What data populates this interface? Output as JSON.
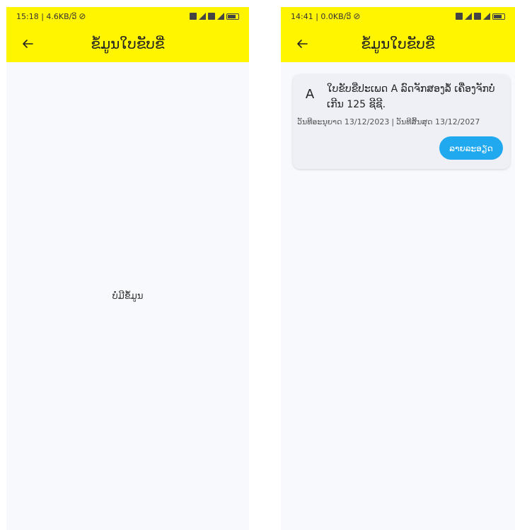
{
  "screens": [
    {
      "status": {
        "time_info": "15:18 | 4.6KB/ວິ"
      },
      "header": {
        "title": "ຂໍ້ມູນໃບຂັບຂີ່"
      },
      "empty_message": "ບໍ່ມີຂໍ້ມູນ"
    },
    {
      "status": {
        "time_info": "14:41 | 0.0KB/ວິ"
      },
      "header": {
        "title": "ຂໍ້ມູນໃບຂັບຂີ່"
      },
      "license_card": {
        "avatar_letter": "A",
        "title": "ໃບຂັບຂີ່ປະເພດ A ລົດຈັກສອງລໍ້ ເຄື່ອງຈັກບໍ່ເກີນ 125 ຊີຊີ.",
        "issue_date": "ວັນທີອະນຸຍາດ 13/12/2023",
        "separator": "|",
        "expiry_date": "ວັນທີສິ້ນສຸດ 13/12/2027",
        "detail_label": "ລາຍລະອຽດ"
      }
    }
  ],
  "colors": {
    "appbar": "#fff500",
    "accent_button": "#21a9f0",
    "background": "#f8f9fc"
  },
  "icons": {
    "back": "arrow-left-icon",
    "wifi_off": "wifi-off-icon",
    "signal": "signal-icon",
    "battery": "battery-icon"
  }
}
